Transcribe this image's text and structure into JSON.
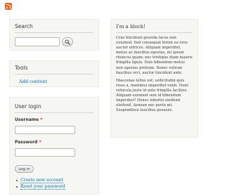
{
  "search": {
    "title": "Search",
    "input_placeholder": "",
    "button_icon": "magnifier-icon"
  },
  "tools": {
    "title": "Tools",
    "links": [
      "Add content"
    ]
  },
  "login": {
    "title": "User login",
    "username_label": "Username",
    "password_label": "Password",
    "required_marker": "*",
    "submit_label": "Log in",
    "links": [
      "Create new account",
      "Reset your password"
    ]
  },
  "block": {
    "title": "I'm a block!",
    "paragraphs": [
      "Cras tincidunt gravida lacus non euismod. Sed consequat lorem eu eros auctor ultrices. Aliquam imperdiet, metus ac faucibus egestas, mi ipsum rhoncus quam; nec tristique diam mauris fringilla ligula. Duis bibendum metus non egestas pretium. Donec rutrum faucibus orci, auctor tincidunt ante.",
      "Maecenas tellus est; sollicitudin quis risus a, maximus imperdiet enim. Nunc vehicula justo id ante fringilla facilisis. Aliquam euismod sem id bibendum imperdiet? Donec lobortis eleifend eleifend. Aenean nec porta mi. Suspendisse faucibus posuere."
    ]
  },
  "colors": {
    "link": "#0071b3",
    "block_bg": "#f6f6f2",
    "rss": "#f26522",
    "required": "#e0171f"
  },
  "icons": [
    "rss-feed-icon",
    "magnifier-icon"
  ]
}
